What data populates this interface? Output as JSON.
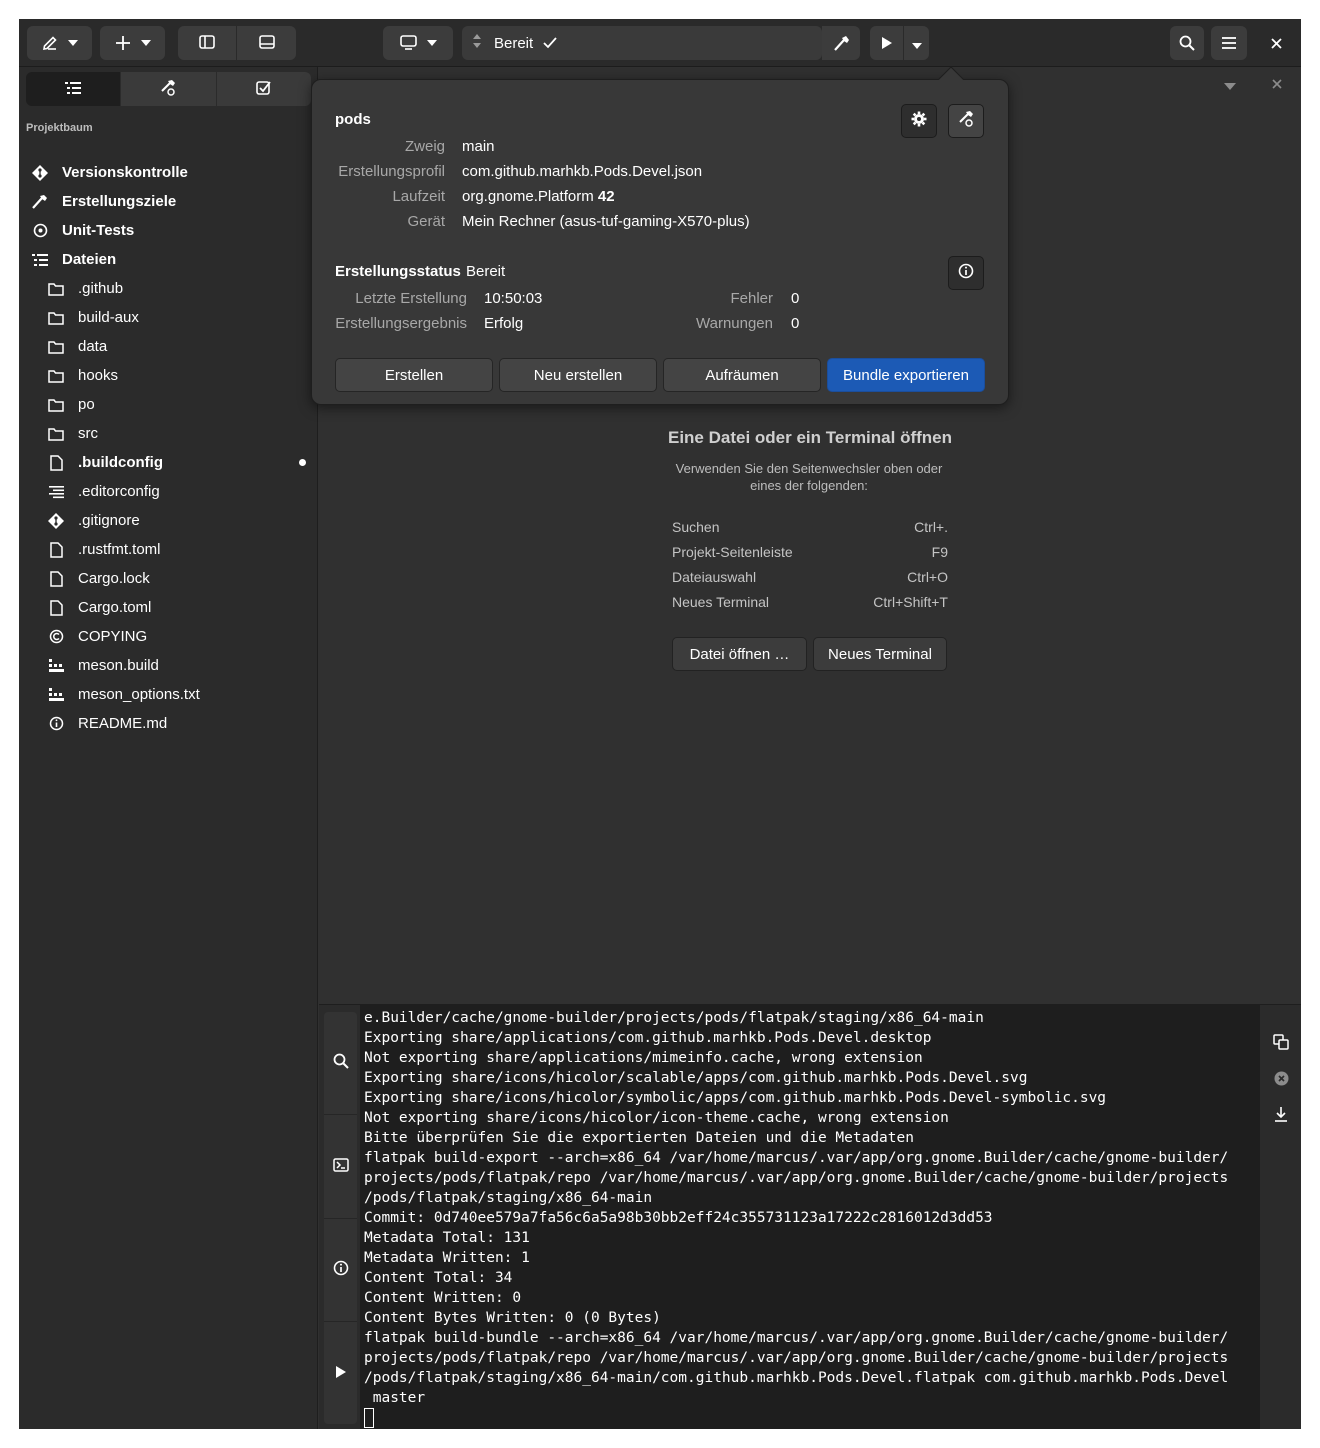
{
  "header": {
    "status_text": "Bereit"
  },
  "sidebar": {
    "tree_title": "Projektbaum",
    "top_items": [
      {
        "label": "Versionskontrolle",
        "icon": "git-icon"
      },
      {
        "label": "Erstellungsziele",
        "icon": "hammer-icon"
      },
      {
        "label": "Unit-Tests",
        "icon": "unit-test-icon"
      },
      {
        "label": "Dateien",
        "icon": "list-icon"
      }
    ],
    "files": [
      {
        "label": ".github",
        "icon": "folder-icon"
      },
      {
        "label": "build-aux",
        "icon": "folder-icon"
      },
      {
        "label": "data",
        "icon": "folder-icon"
      },
      {
        "label": "hooks",
        "icon": "folder-icon"
      },
      {
        "label": "po",
        "icon": "folder-icon"
      },
      {
        "label": "src",
        "icon": "folder-icon"
      },
      {
        "label": ".buildconfig",
        "icon": "file-icon",
        "modified": true
      },
      {
        "label": ".editorconfig",
        "icon": "config-file-icon"
      },
      {
        "label": ".gitignore",
        "icon": "git-icon"
      },
      {
        "label": ".rustfmt.toml",
        "icon": "file-icon"
      },
      {
        "label": "Cargo.lock",
        "icon": "file-icon"
      },
      {
        "label": "Cargo.toml",
        "icon": "file-icon"
      },
      {
        "label": "COPYING",
        "icon": "copyright-icon"
      },
      {
        "label": "meson.build",
        "icon": "build-file-icon"
      },
      {
        "label": "meson_options.txt",
        "icon": "build-file-icon"
      },
      {
        "label": "README.md",
        "icon": "info-icon"
      }
    ]
  },
  "main": {
    "empty_title": "Eine Datei oder ein Terminal öffnen",
    "empty_subtitle": "Verwenden Sie den Seitenwechsler oben oder eines der folgenden:",
    "shortcuts": [
      {
        "label": "Suchen",
        "key": "Ctrl+."
      },
      {
        "label": "Projekt-Seitenleiste",
        "key": "F9"
      },
      {
        "label": "Dateiauswahl",
        "key": "Ctrl+O"
      },
      {
        "label": "Neues Terminal",
        "key": "Ctrl+Shift+T"
      }
    ],
    "open_file_button": "Datei öffnen …",
    "new_terminal_button": "Neues Terminal"
  },
  "popover": {
    "project_name": "pods",
    "info": [
      {
        "label": "Zweig",
        "value": "main"
      },
      {
        "label": "Erstellungsprofil",
        "value": "com.github.marhkb.Pods.Devel.json"
      },
      {
        "label": "Laufzeit",
        "value": "org.gnome.Platform",
        "value_bold": "42"
      },
      {
        "label": "Gerät",
        "value": "Mein Rechner (asus-tuf-gaming-X570-plus)"
      }
    ],
    "build_status_label": "Erstellungsstatus",
    "build_status_value": "Bereit",
    "last_build_label": "Letzte Erstellung",
    "last_build_value": "10:50:03",
    "result_label": "Erstellungsergebnis",
    "result_value": "Erfolg",
    "errors_label": "Fehler",
    "errors_value": "0",
    "warnings_label": "Warnungen",
    "warnings_value": "0",
    "buttons": {
      "build": "Erstellen",
      "rebuild": "Neu erstellen",
      "clean": "Aufräumen",
      "export": "Bundle exportieren"
    }
  },
  "terminal": {
    "lines": [
      "e.Builder/cache/gnome-builder/projects/pods/flatpak/staging/x86_64-main",
      "Exporting share/applications/com.github.marhkb.Pods.Devel.desktop",
      "Not exporting share/applications/mimeinfo.cache, wrong extension",
      "Exporting share/icons/hicolor/scalable/apps/com.github.marhkb.Pods.Devel.svg",
      "Exporting share/icons/hicolor/symbolic/apps/com.github.marhkb.Pods.Devel-symbolic.svg",
      "Not exporting share/icons/hicolor/icon-theme.cache, wrong extension",
      "Bitte überprüfen Sie die exportierten Dateien und die Metadaten",
      "flatpak build-export --arch=x86_64 /var/home/marcus/.var/app/org.gnome.Builder/cache/gnome-builder/",
      "projects/pods/flatpak/repo /var/home/marcus/.var/app/org.gnome.Builder/cache/gnome-builder/projects",
      "/pods/flatpak/staging/x86_64-main",
      "Commit: 0d740ee579a7fa56c6a5a98b30bb2eff24c355731123a17222c2816012d3dd53",
      "Metadata Total: 131",
      "Metadata Written: 1",
      "Content Total: 34",
      "Content Written: 0",
      "Content Bytes Written: 0 (0 Bytes)",
      "flatpak build-bundle --arch=x86_64 /var/home/marcus/.var/app/org.gnome.Builder/cache/gnome-builder/",
      "projects/pods/flatpak/repo /var/home/marcus/.var/app/org.gnome.Builder/cache/gnome-builder/projects",
      "/pods/flatpak/staging/x86_64-main/com.github.marhkb.Pods.Devel.flatpak com.github.marhkb.Pods.Devel",
      " master"
    ]
  },
  "colors": {
    "accent": "#1c5ab5",
    "window_bg": "#303030",
    "terminal_bg": "#1e1e1e"
  }
}
